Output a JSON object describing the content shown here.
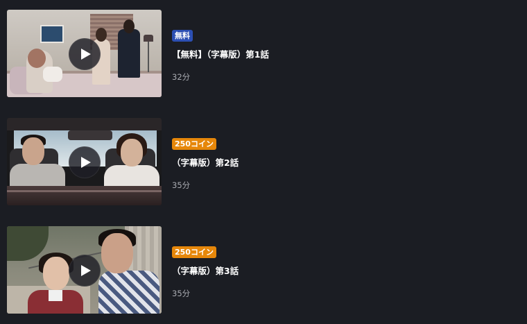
{
  "episodes": [
    {
      "badge": "無料",
      "badge_type": "free",
      "title": "【無料】（字幕版）第1話",
      "duration": "32分"
    },
    {
      "badge": "250コイン",
      "badge_type": "coin",
      "title": "（字幕版）第2話",
      "duration": "35分"
    },
    {
      "badge": "250コイン",
      "badge_type": "coin",
      "title": "（字幕版）第3話",
      "duration": "35分"
    }
  ],
  "colors": {
    "background": "#1b1d23",
    "free_badge": "#2c4fb3",
    "coin_badge": "#e6870a",
    "title_text": "#ffffff",
    "duration_text": "#a9abb1"
  },
  "icons": {
    "play": "play-icon"
  }
}
